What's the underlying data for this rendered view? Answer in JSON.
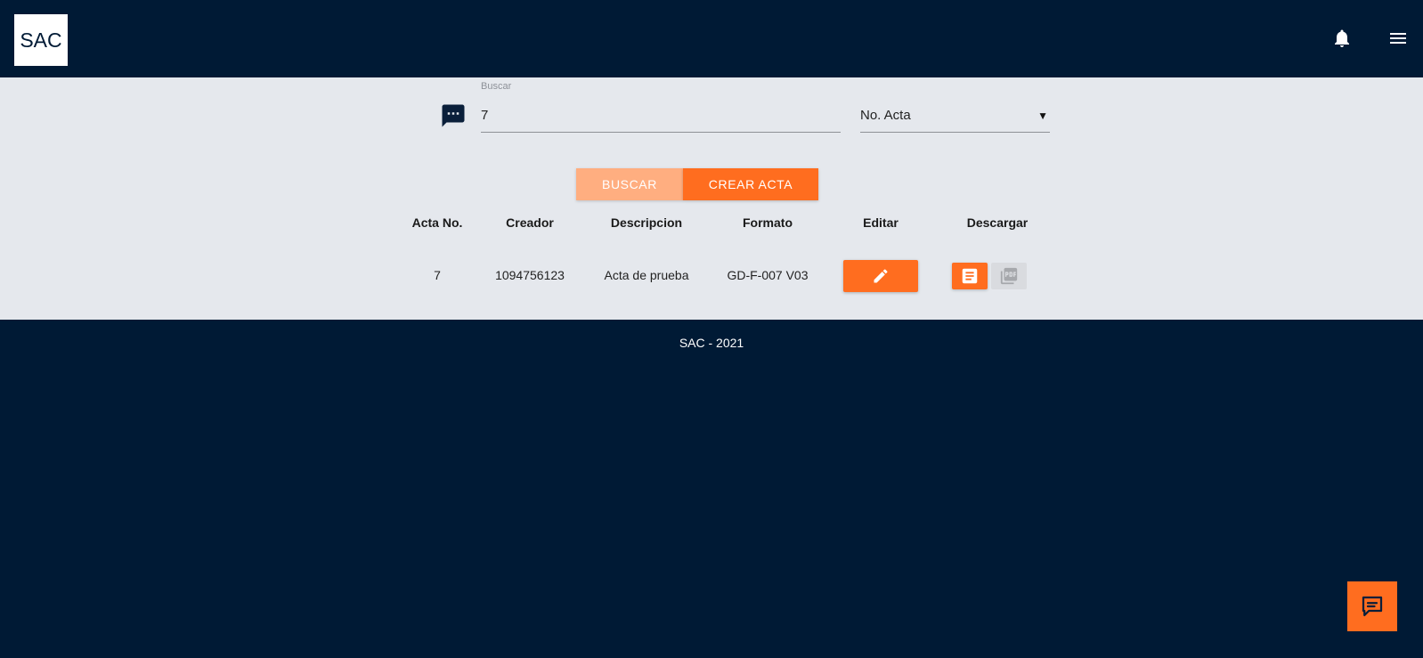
{
  "header": {
    "logo_text": "SAC",
    "icons": [
      "bell-icon",
      "menu-icon"
    ]
  },
  "search": {
    "label": "Buscar",
    "value": "7",
    "icon": "chat-dots-icon",
    "filter_selected": "No. Acta"
  },
  "actions": {
    "buscar_label": "BUSCAR",
    "crear_label": "CREAR ACTA"
  },
  "table": {
    "headers": [
      "Acta No.",
      "Creador",
      "Descripcion",
      "Formato",
      "Editar",
      "Descargar"
    ],
    "rows": [
      {
        "acta_no": "7",
        "creador": "1094756123",
        "descripcion": "Acta de prueba",
        "formato": "GD-F-007 V03",
        "edit_icon": "pencil-icon",
        "download_icons": [
          "document-icon",
          "pdf-icon"
        ]
      }
    ]
  },
  "footer": {
    "text": "SAC - 2021"
  },
  "feedback": {
    "icon": "feedback-chat-icon"
  },
  "colors": {
    "navy": "#001a35",
    "orange": "#ff6d1f",
    "orange_light": "#ffae80",
    "panel": "#e5e8ed"
  }
}
